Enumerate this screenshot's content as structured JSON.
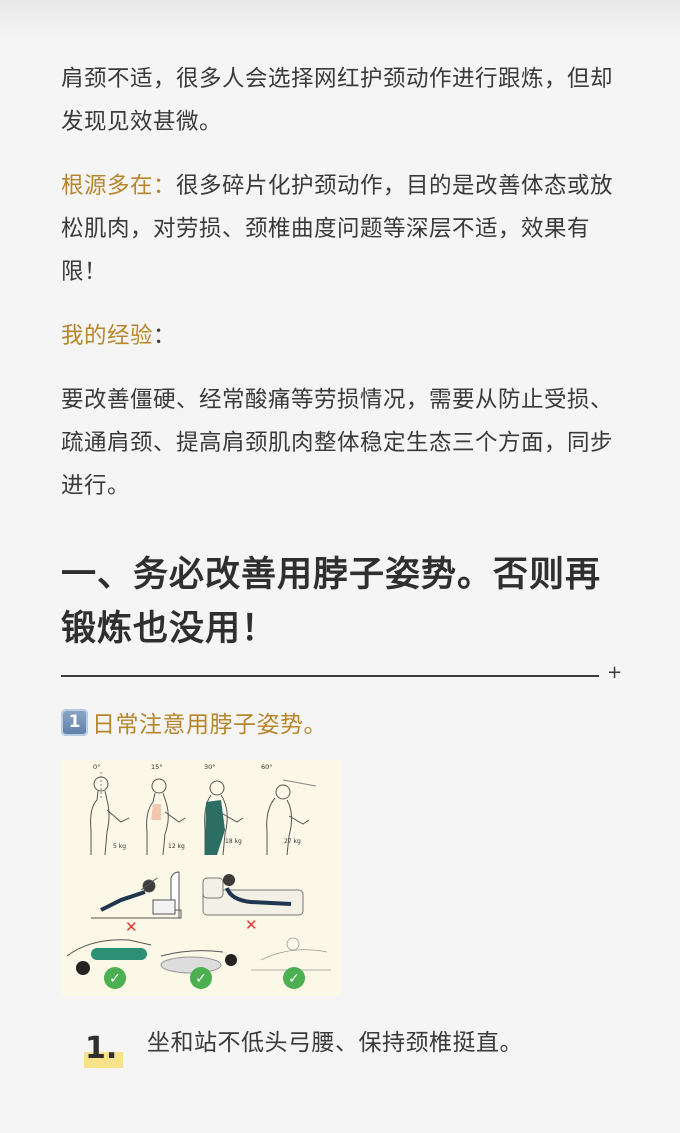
{
  "paragraphs": {
    "p1": "肩颈不适，很多人会选择网红护颈动作进行跟炼，但却发现见效甚微。",
    "p2_label": "根源多在：",
    "p2_text": "很多碎片化护颈动作，目的是改善体态或放松肌肉，对劳损、颈椎曲度问题等深层不适，效果有限！",
    "p3_label": "我的经验",
    "p3_colon": "：",
    "p4": "要改善僵硬、经常酸痛等劳损情况，需要从防止受损、疏通肩颈、提高肩颈肌肉整体稳定生态三个方面，同步进行。"
  },
  "section": {
    "heading": "一、务必改善用脖子姿势。否则再锻炼也没用！",
    "divider_symbol": "+"
  },
  "subsection": {
    "keycap": "1",
    "title": "日常注意用脖子姿势。"
  },
  "illustration": {
    "angles": [
      "0°",
      "15°",
      "30°",
      "60°"
    ],
    "weights": [
      "5 kg",
      "12 kg",
      "18 kg",
      "27 kg"
    ],
    "wrong_mark": "✕",
    "right_mark": "✓"
  },
  "list": {
    "item1_number": "1.",
    "item1_text": "坐和站不低头弓腰、保持颈椎挺直。"
  },
  "colors": {
    "accent_gold": "#b8862a",
    "highlight_yellow": "#f7e28a",
    "check_green": "#4caf50",
    "cross_red": "#e53935"
  }
}
